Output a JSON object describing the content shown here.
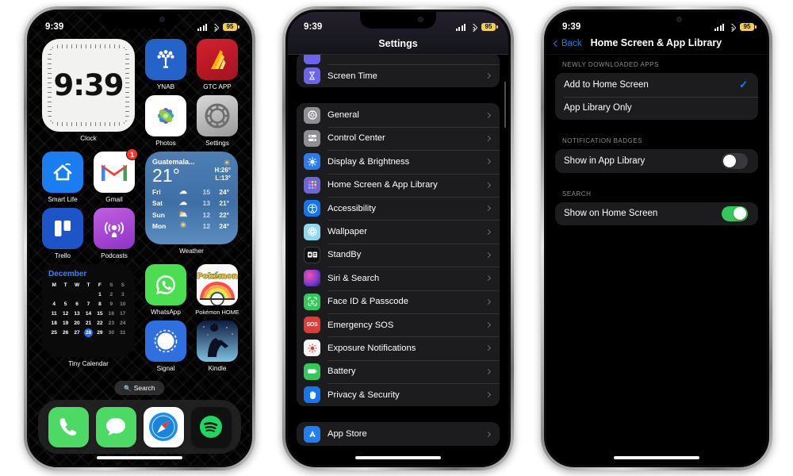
{
  "status_bar": {
    "time": "9:39",
    "battery": "95",
    "signal_icon": "cellular-bars-icon",
    "wifi_icon": "wifi-icon"
  },
  "phone1": {
    "name": "iPhone Home Screen",
    "clock_widget": {
      "time": "9:39",
      "label": "Clock"
    },
    "apps_row1": [
      {
        "label": "YNAB",
        "icon": "ynab-app-icon"
      },
      {
        "label": "GTC APP",
        "icon": "gtc-app-icon"
      }
    ],
    "apps_row2": [
      {
        "label": "Photos",
        "icon": "photos-app-icon"
      },
      {
        "label": "Settings",
        "icon": "settings-app-icon"
      }
    ],
    "apps_row3": [
      {
        "label": "Smart Life",
        "icon": "smart-life-app-icon",
        "badge": ""
      },
      {
        "label": "Gmail",
        "icon": "gmail-app-icon",
        "badge": "1"
      }
    ],
    "apps_row4": [
      {
        "label": "Trello",
        "icon": "trello-app-icon"
      },
      {
        "label": "Podcasts",
        "icon": "podcasts-app-icon"
      }
    ],
    "apps_row5": [
      {
        "label": "WhatsApp",
        "icon": "whatsapp-app-icon"
      },
      {
        "label": "Pokémon HOME",
        "icon": "pokemon-home-app-icon"
      }
    ],
    "apps_row6": [
      {
        "label": "Signal",
        "icon": "signal-app-icon"
      },
      {
        "label": "Kindle",
        "icon": "kindle-app-icon"
      }
    ],
    "weather_widget": {
      "label": "Weather",
      "city": "Guatemala...",
      "temp": "21°",
      "high": "H:26°",
      "low": "L:13°",
      "condition_icon": "sun-icon",
      "forecast": [
        {
          "day": "Fri",
          "icon": "cloud-icon",
          "low": "15",
          "high": "24°"
        },
        {
          "day": "Sat",
          "icon": "cloud-icon",
          "low": "13",
          "high": "21°"
        },
        {
          "day": "Sun",
          "icon": "sun-cloud-icon",
          "low": "12",
          "high": "22°"
        },
        {
          "day": "Mon",
          "icon": "sun-icon",
          "low": "12",
          "high": "24°"
        }
      ]
    },
    "calendar_widget": {
      "label": "Tiny Calendar",
      "month": "December",
      "weekdays": [
        "M",
        "T",
        "W",
        "T",
        "F",
        "S",
        "S"
      ],
      "today": "28",
      "days": [
        "",
        "",
        "",
        "",
        "1",
        "2",
        "3",
        "4",
        "5",
        "6",
        "7",
        "8",
        "9",
        "10",
        "11",
        "12",
        "13",
        "14",
        "15",
        "16",
        "17",
        "18",
        "19",
        "20",
        "21",
        "22",
        "23",
        "24",
        "25",
        "26",
        "27",
        "28",
        "29",
        "30",
        "31"
      ]
    },
    "search": {
      "label": "Search",
      "icon": "search-icon"
    },
    "dock": [
      {
        "label": "Phone",
        "icon": "phone-app-icon"
      },
      {
        "label": "Messages",
        "icon": "messages-app-icon"
      },
      {
        "label": "Safari",
        "icon": "safari-app-icon"
      },
      {
        "label": "Spotify",
        "icon": "spotify-app-icon"
      }
    ]
  },
  "phone2": {
    "title": "Settings",
    "group_cut": [
      {
        "label": "Screen Time",
        "icon": "hourglass-icon",
        "color": "#6c63f0"
      }
    ],
    "group_main": [
      {
        "label": "General",
        "icon": "gear-icon",
        "color": "#8e8e93"
      },
      {
        "label": "Control Center",
        "icon": "sliders-icon",
        "color": "#8e8e93"
      },
      {
        "label": "Display & Brightness",
        "icon": "brightness-icon",
        "color": "#2a7af2"
      },
      {
        "label": "Home Screen & App Library",
        "icon": "app-grid-icon",
        "color": "#6f63e0"
      },
      {
        "label": "Accessibility",
        "icon": "accessibility-icon",
        "color": "#1574f0"
      },
      {
        "label": "Wallpaper",
        "icon": "wallpaper-icon",
        "color": "#5ac8e8"
      },
      {
        "label": "StandBy",
        "icon": "standby-icon",
        "color": "#1c1c1e"
      },
      {
        "label": "Siri & Search",
        "icon": "siri-icon",
        "color": "#b44adf"
      },
      {
        "label": "Face ID & Passcode",
        "icon": "face-id-icon",
        "color": "#34c759"
      },
      {
        "label": "Emergency SOS",
        "icon": "sos-icon",
        "color": "#e53935"
      },
      {
        "label": "Exposure Notifications",
        "icon": "exposure-icon",
        "color": "#f5f5f5"
      },
      {
        "label": "Battery",
        "icon": "battery-icon",
        "color": "#34c759"
      },
      {
        "label": "Privacy & Security",
        "icon": "hand-icon",
        "color": "#1574f0"
      }
    ],
    "group_store": [
      {
        "label": "App Store",
        "icon": "app-store-icon",
        "color": "#1f7ef0"
      }
    ]
  },
  "phone3": {
    "back_label": "Back",
    "title": "Home Screen & App Library",
    "sections": [
      {
        "header": "NEWLY DOWNLOADED APPS",
        "rows": [
          {
            "label": "Add to Home Screen",
            "control": "check",
            "checked": true
          },
          {
            "label": "App Library Only",
            "control": "check",
            "checked": false
          }
        ]
      },
      {
        "header": "NOTIFICATION BADGES",
        "rows": [
          {
            "label": "Show in App Library",
            "control": "toggle",
            "on": false
          }
        ]
      },
      {
        "header": "SEARCH",
        "rows": [
          {
            "label": "Show on Home Screen",
            "control": "toggle",
            "on": true
          }
        ]
      }
    ]
  },
  "colors": {
    "accent_blue": "#0a84ff",
    "toggle_on": "#34c759",
    "toggle_off": "#39393d",
    "group_bg": "#1c1c1e",
    "battery_badge": "#f3d045"
  }
}
